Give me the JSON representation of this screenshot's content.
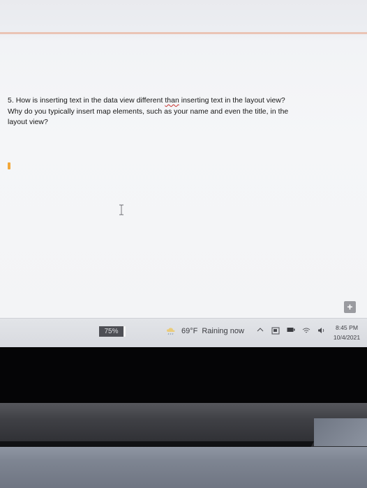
{
  "question": {
    "line1_before": "5. How is inserting text in the data view different ",
    "line1_misspelled": "than",
    "line1_after": " inserting text in the layout view?",
    "line2": "Why do you typically insert map elements, such as your name and even the title, in the",
    "line3": "layout view?"
  },
  "taskbar": {
    "battery_label": "75%",
    "weather_temp": "69°F",
    "weather_condition": "Raining now",
    "clock_time": "8:45 PM",
    "clock_date": "10/4/2021",
    "add_button_label": "+"
  },
  "icons": {
    "cursor": "text-caret-icon",
    "ibeam": "ibeam-cursor-icon",
    "weather": "rain-cloud-icon",
    "chevron": "chevron-up-icon",
    "meet": "meet-now-icon",
    "battery": "battery-icon",
    "wifi": "wifi-icon",
    "volume": "volume-icon"
  },
  "colors": {
    "caret": "#f2a83a",
    "spellcheck_underline": "#c9302c",
    "battery_badge": "#4e4f55"
  }
}
